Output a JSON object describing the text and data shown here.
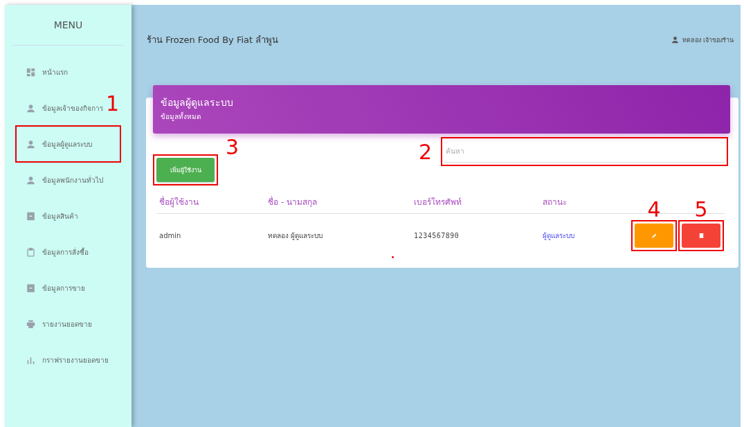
{
  "sidebar": {
    "title": "MENU",
    "items": [
      {
        "label": "หน้าแรก",
        "kind": "dashboard"
      },
      {
        "label": "ข้อมูลเจ้าของกิจการ",
        "kind": "person"
      },
      {
        "label": "ข้อมูลผู้ดูแลระบบ",
        "kind": "person",
        "callout": {
          "number": "1"
        }
      },
      {
        "label": "ข้อมูลพนักงานทั่วไป",
        "kind": "person"
      },
      {
        "label": "ข้อมูลสินค้า",
        "kind": "box"
      },
      {
        "label": "ข้อมูลการสั่งซื้อ",
        "kind": "clipboard"
      },
      {
        "label": "ข้อมูลการขาย",
        "kind": "box"
      },
      {
        "label": "รายงานยอดขาย",
        "kind": "printer"
      },
      {
        "label": "กราฟรายงานยอดขาย",
        "kind": "chart"
      }
    ]
  },
  "header": {
    "shop_title": "ร้าน Frozen Food By Fiat ลำพูน",
    "user": "ทดลอง เจ้าของร้าน"
  },
  "card": {
    "title": "ข้อมูลผู้ดูแลระบบ",
    "subtitle": "ข้อมูลทั้งหมด",
    "search": {
      "placeholder": "ค้นหา",
      "callout": {
        "number": "2"
      }
    },
    "add_button": {
      "label": "เพิ่มผู้ใช้งาน",
      "callout": {
        "number": "3"
      }
    },
    "table": {
      "columns": [
        {
          "label": "ชื่อผู้ใช้งาน",
          "kind": "text"
        },
        {
          "label": "ชื่อ - นามสกุล",
          "kind": "text"
        },
        {
          "label": "เบอร์โทรศัพท์",
          "kind": "mono"
        },
        {
          "label": "สถานะ",
          "kind": "link"
        }
      ],
      "rows": [
        {
          "cells": [
            "admin",
            "ทดลอง ผู้ดูแลระบบ",
            "1234567890",
            "ผู้ดูแลระบบ"
          ],
          "edit_callout": {
            "number": "4"
          },
          "delete_callout": {
            "number": "5"
          }
        }
      ]
    }
  }
}
